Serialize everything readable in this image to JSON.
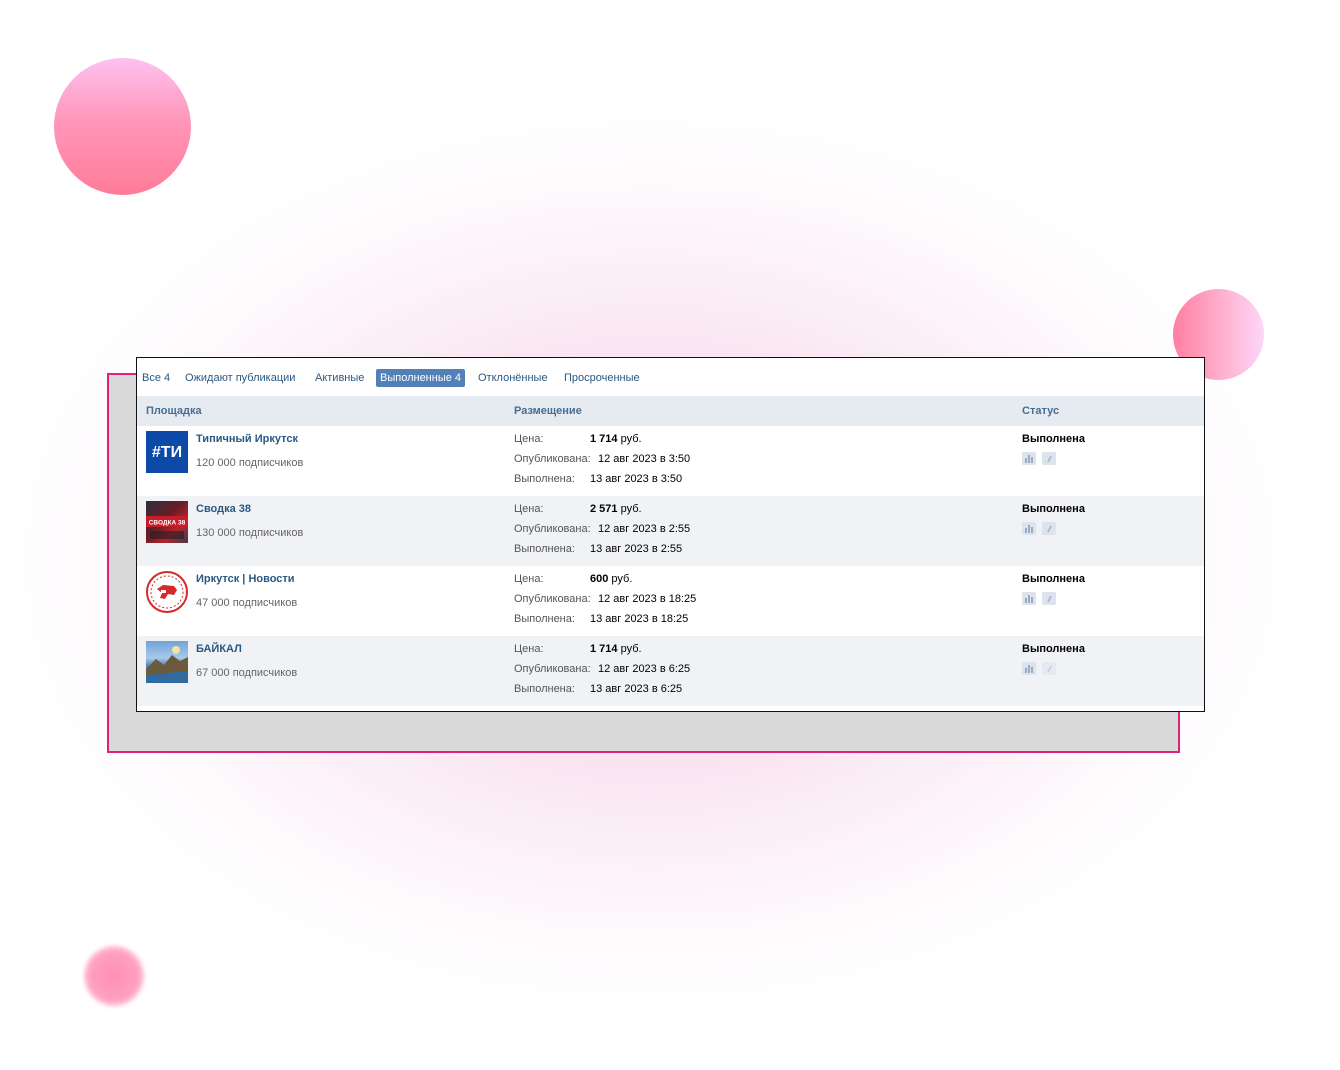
{
  "tabs": [
    {
      "label": "Все 4",
      "active": false
    },
    {
      "label": "Ожидают публикации",
      "active": false
    },
    {
      "label": "Активные",
      "active": false
    },
    {
      "label": "Выполненные 4",
      "active": true
    },
    {
      "label": "Отклонённые",
      "active": false
    },
    {
      "label": "Просроченные",
      "active": false
    }
  ],
  "table": {
    "headers": {
      "site": "Площадка",
      "placement": "Размещение",
      "status": "Статус"
    },
    "rows": [
      {
        "name": "Типичный Иркутск",
        "subscribers": "120 000 подписчиков",
        "price_label": "Цена:",
        "price_value": "1 714",
        "price_unit": "руб.",
        "published_label": "Опубликована:",
        "published_value": "12 авг 2023 в 3:50",
        "completed_label": "Выполнена:",
        "completed_value": "13 авг 2023 в 3:50",
        "status": "Выполнена",
        "avatar_text": "#ТИ",
        "avatar_icon": "typical-irkutsk-logo"
      },
      {
        "name": "Сводка 38",
        "subscribers": "130 000 подписчиков",
        "price_label": "Цена:",
        "price_value": "2 571",
        "price_unit": "руб.",
        "published_label": "Опубликована:",
        "published_value": "12 авг 2023 в 2:55",
        "completed_label": "Выполнена:",
        "completed_value": "13 авг 2023 в 2:55",
        "status": "Выполнена",
        "avatar_text": "СВОДКА 38",
        "avatar_icon": "svodka38-logo"
      },
      {
        "name": "Иркутск | Новости",
        "subscribers": "47 000 подписчиков",
        "price_label": "Цена:",
        "price_value": "600",
        "price_unit": "руб.",
        "published_label": "Опубликована:",
        "published_value": "12 авг 2023 в 18:25",
        "completed_label": "Выполнена:",
        "completed_value": "13 авг 2023 в 18:25",
        "status": "Выполнена",
        "avatar_icon": "irkutsk-babr-emblem"
      },
      {
        "name": "БАЙКАЛ",
        "subscribers": "67 000 подписчиков",
        "price_label": "Цена:",
        "price_value": "1 714",
        "price_unit": "руб.",
        "published_label": "Опубликована:",
        "published_value": "12 авг 2023 в 6:25",
        "completed_label": "Выполнена:",
        "completed_value": "13 авг 2023 в 6:25",
        "status": "Выполнена",
        "avatar_icon": "baikal-landscape-photo"
      }
    ]
  },
  "colors": {
    "accent": "#e0217a",
    "link": "#2a5885",
    "tab_active_bg": "#5181b8",
    "header_bg": "#e5ebf1"
  }
}
